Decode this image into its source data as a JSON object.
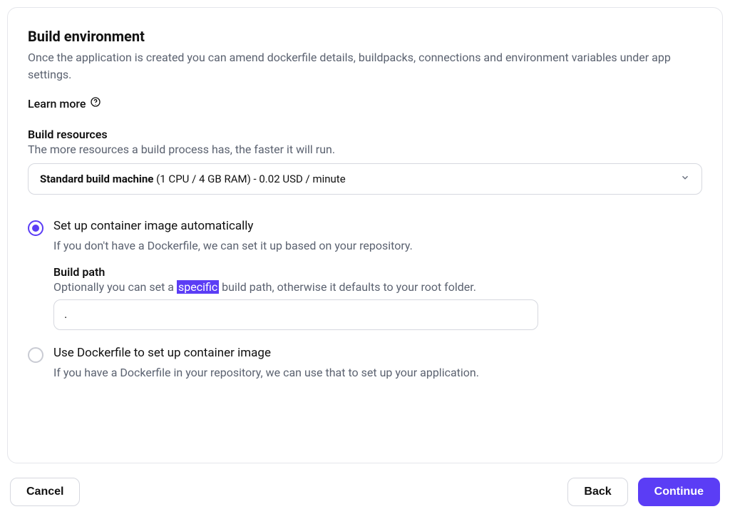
{
  "heading": "Build environment",
  "description": "Once the application is created you can amend dockerfile details, buildpacks, connections and environment variables under app settings.",
  "learn_more": "Learn more",
  "build_resources": {
    "label": "Build resources",
    "description": "The more resources a build process has, the faster it will run.",
    "selected_bold": "Standard build machine",
    "selected_rest": " (1 CPU / 4 GB RAM) - 0.02 USD / minute"
  },
  "options": {
    "auto": {
      "title": "Set up container image automatically",
      "description": "If you don't have a Dockerfile, we can set it up based on your repository.",
      "selected": true,
      "build_path": {
        "label": "Build path",
        "desc_pre": "Optionally you can set a ",
        "desc_hl": "specific",
        "desc_post": " build path, otherwise it defaults to your root folder.",
        "value": "."
      }
    },
    "dockerfile": {
      "title": "Use Dockerfile to set up container image",
      "description": "If you have a Dockerfile in your repository, we can use that to set up your application.",
      "selected": false
    }
  },
  "footer": {
    "cancel": "Cancel",
    "back": "Back",
    "continue": "Continue"
  },
  "colors": {
    "accent": "#5b3df5",
    "muted": "#5b6270",
    "border": "#d6d8df"
  }
}
